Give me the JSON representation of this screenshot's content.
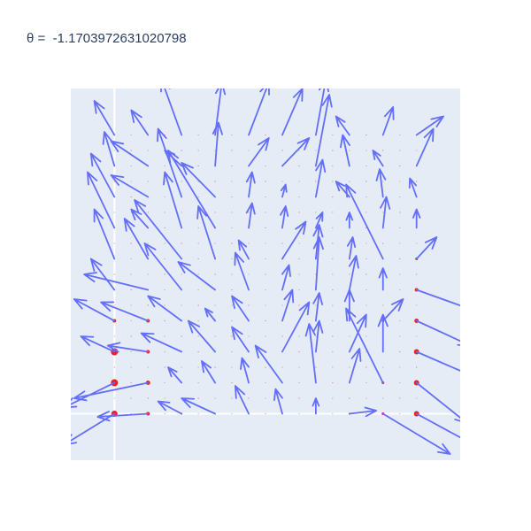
{
  "chart_data": {
    "type": "quiver",
    "title": "θ =  -1.1703972631020798",
    "xlabel": "",
    "ylabel": "",
    "xlim": [
      -1.3,
      10.3
    ],
    "ylim": [
      -1.5,
      10.5
    ],
    "grid": false,
    "zero_lines": true,
    "colors": {
      "arrows": "#636efa",
      "markers": "#ef1f1f",
      "plot_bg": "#e5ecf6",
      "paper_bg": "#ffffff",
      "zeroline": "#ffffff",
      "title": "#2a3f5f"
    },
    "grid_spacing": 0.5,
    "arrows": [
      {
        "x": 0,
        "y": 9,
        "u": -0.6,
        "v": 1.1
      },
      {
        "x": 0,
        "y": 8,
        "u": -0.3,
        "v": 1.1
      },
      {
        "x": 0,
        "y": 7,
        "u": -0.7,
        "v": 1.4
      },
      {
        "x": 0,
        "y": 6,
        "u": -0.8,
        "v": 1.8
      },
      {
        "x": 0,
        "y": 5,
        "u": -0.6,
        "v": 1.6
      },
      {
        "x": 0,
        "y": 4,
        "u": -0.7,
        "v": 1.0
      },
      {
        "x": 0,
        "y": 3,
        "u": -1.2,
        "v": 0.7
      },
      {
        "x": 0,
        "y": 2,
        "u": -1.0,
        "v": 0.5
      },
      {
        "x": 0,
        "y": 1,
        "u": -1.5,
        "v": -0.8
      },
      {
        "x": 0,
        "y": 0,
        "u": -1.5,
        "v": -1.0
      },
      {
        "x": 1,
        "y": 9,
        "u": -0.5,
        "v": 0.8
      },
      {
        "x": 1,
        "y": 8,
        "u": -1.1,
        "v": 0.8
      },
      {
        "x": 1,
        "y": 7,
        "u": -1.1,
        "v": 0.7
      },
      {
        "x": 1,
        "y": 6,
        "u": -0.5,
        "v": 0.6
      },
      {
        "x": 1,
        "y": 5,
        "u": -0.7,
        "v": 1.3
      },
      {
        "x": 1,
        "y": 4,
        "u": -1.9,
        "v": 0.5
      },
      {
        "x": 1,
        "y": 3,
        "u": -1.4,
        "v": 0.6
      },
      {
        "x": 1,
        "y": 2,
        "u": -1.2,
        "v": 0.2
      },
      {
        "x": 1,
        "y": 1,
        "u": -2.2,
        "v": -0.5
      },
      {
        "x": 1,
        "y": 0,
        "u": -1.5,
        "v": -0.1
      },
      {
        "x": 2,
        "y": 9,
        "u": -0.6,
        "v": 1.8
      },
      {
        "x": 2,
        "y": 8,
        "u": -0.5,
        "v": 0.5
      },
      {
        "x": 2,
        "y": 7,
        "u": -0.7,
        "v": 2.2
      },
      {
        "x": 2,
        "y": 6,
        "u": -0.5,
        "v": 1.8
      },
      {
        "x": 2,
        "y": 5,
        "u": -1.4,
        "v": 1.9
      },
      {
        "x": 2,
        "y": 4,
        "u": -1.1,
        "v": 1.5
      },
      {
        "x": 2,
        "y": 3,
        "u": -1.0,
        "v": 0.8
      },
      {
        "x": 2,
        "y": 2,
        "u": -1.2,
        "v": 0.6
      },
      {
        "x": 2,
        "y": 1,
        "u": -0.4,
        "v": 0.5
      },
      {
        "x": 2,
        "y": 0,
        "u": -0.7,
        "v": 0.4
      },
      {
        "x": 3,
        "y": 9,
        "u": 0.2,
        "v": 1.7
      },
      {
        "x": 3,
        "y": 8,
        "u": 0.1,
        "v": 1.4
      },
      {
        "x": 3,
        "y": 7,
        "u": -1.0,
        "v": 1.1
      },
      {
        "x": 3,
        "y": 6,
        "u": -1.4,
        "v": 2.5
      },
      {
        "x": 3,
        "y": 5,
        "u": -0.5,
        "v": 1.7
      },
      {
        "x": 3,
        "y": 4,
        "u": -1.1,
        "v": 0.9
      },
      {
        "x": 3,
        "y": 3,
        "u": -0.3,
        "v": 0.4
      },
      {
        "x": 3,
        "y": 2,
        "u": -0.8,
        "v": 1.0
      },
      {
        "x": 3,
        "y": 1,
        "u": -0.4,
        "v": 0.7
      },
      {
        "x": 3,
        "y": 0,
        "u": -1.0,
        "v": 0.5
      },
      {
        "x": 4,
        "y": 9,
        "u": 0.6,
        "v": 1.7
      },
      {
        "x": 4,
        "y": 8,
        "u": 0.6,
        "v": 0.9
      },
      {
        "x": 4,
        "y": 7,
        "u": 0.1,
        "v": 0.8
      },
      {
        "x": 4,
        "y": 6,
        "u": 0.1,
        "v": 0.8
      },
      {
        "x": 4,
        "y": 5,
        "u": -0.3,
        "v": 0.6
      },
      {
        "x": 4,
        "y": 4,
        "u": -0.4,
        "v": 1.2
      },
      {
        "x": 4,
        "y": 3,
        "u": -0.5,
        "v": 0.8
      },
      {
        "x": 4,
        "y": 2,
        "u": -0.5,
        "v": 0.8
      },
      {
        "x": 4,
        "y": 1,
        "u": -0.2,
        "v": 0.8
      },
      {
        "x": 4,
        "y": 0,
        "u": -0.4,
        "v": 0.9
      },
      {
        "x": 5,
        "y": 9,
        "u": 0.6,
        "v": 1.5
      },
      {
        "x": 5,
        "y": 8,
        "u": 0.8,
        "v": 0.9
      },
      {
        "x": 5,
        "y": 7,
        "u": 0.1,
        "v": 0.4
      },
      {
        "x": 5,
        "y": 6,
        "u": 0.1,
        "v": 0.7
      },
      {
        "x": 5,
        "y": 5,
        "u": 0.7,
        "v": 1.2
      },
      {
        "x": 5,
        "y": 4,
        "u": 0.2,
        "v": 0.8
      },
      {
        "x": 5,
        "y": 3,
        "u": 0.3,
        "v": 1.0
      },
      {
        "x": 5,
        "y": 2,
        "u": 0.8,
        "v": 1.6
      },
      {
        "x": 5,
        "y": 1,
        "u": -0.8,
        "v": 1.2
      },
      {
        "x": 5,
        "y": 0,
        "u": -0.2,
        "v": 0.8
      },
      {
        "x": 6,
        "y": 9,
        "u": 0.3,
        "v": 1.8
      },
      {
        "x": 6,
        "y": 8,
        "u": 0.4,
        "v": 2.3
      },
      {
        "x": 6,
        "y": 7,
        "u": 0.2,
        "v": 1.2
      },
      {
        "x": 6,
        "y": 6,
        "u": 0.2,
        "v": 0.5
      },
      {
        "x": 6,
        "y": 5,
        "u": 0.1,
        "v": 1.1
      },
      {
        "x": 6,
        "y": 4,
        "u": 0.1,
        "v": 1.7
      },
      {
        "x": 6,
        "y": 3,
        "u": 0.1,
        "v": 0.9
      },
      {
        "x": 6,
        "y": 2,
        "u": 0.1,
        "v": 1.0
      },
      {
        "x": 6,
        "y": 1,
        "u": -0.2,
        "v": 1.9
      },
      {
        "x": 6,
        "y": 0,
        "u": 0.0,
        "v": 0.5
      },
      {
        "x": 7,
        "y": 9,
        "u": -0.4,
        "v": 0.6
      },
      {
        "x": 7,
        "y": 8,
        "u": -0.2,
        "v": 1.0
      },
      {
        "x": 7,
        "y": 7,
        "u": -0.4,
        "v": 0.5
      },
      {
        "x": 7,
        "y": 6,
        "u": 0.0,
        "v": 0.5
      },
      {
        "x": 7,
        "y": 5,
        "u": 0.1,
        "v": 0.7
      },
      {
        "x": 7,
        "y": 4,
        "u": 0.2,
        "v": 1.1
      },
      {
        "x": 7,
        "y": 3,
        "u": 0.0,
        "v": 1.0
      },
      {
        "x": 7,
        "y": 2,
        "u": 0.5,
        "v": 1.2
      },
      {
        "x": 7,
        "y": 1,
        "u": 0.3,
        "v": 1.1
      },
      {
        "x": 7,
        "y": 0,
        "u": 0.8,
        "v": 0.1
      },
      {
        "x": 8,
        "y": 9,
        "u": 0.3,
        "v": 0.9
      },
      {
        "x": 8,
        "y": 8,
        "u": -0.3,
        "v": 0.5
      },
      {
        "x": 8,
        "y": 7,
        "u": -0.1,
        "v": 0.9
      },
      {
        "x": 8,
        "y": 6,
        "u": 0.1,
        "v": 1.0
      },
      {
        "x": 8,
        "y": 5,
        "u": -1.1,
        "v": 2.4
      },
      {
        "x": 8,
        "y": 4,
        "u": 0.0,
        "v": 0.7
      },
      {
        "x": 8,
        "y": 3,
        "u": 0.6,
        "v": 0.7
      },
      {
        "x": 8,
        "y": 2,
        "u": 0.0,
        "v": 1.2
      },
      {
        "x": 8,
        "y": 1,
        "u": -1.1,
        "v": 2.4
      },
      {
        "x": 8,
        "y": 0,
        "u": 2.0,
        "v": -1.3
      },
      {
        "x": 9,
        "y": 9,
        "u": 0.8,
        "v": 0.6
      },
      {
        "x": 9,
        "y": 8,
        "u": 0.5,
        "v": 1.2
      },
      {
        "x": 9,
        "y": 7,
        "u": -0.2,
        "v": 0.6
      },
      {
        "x": 9,
        "y": 6,
        "u": 0.0,
        "v": 0.6
      },
      {
        "x": 9,
        "y": 5,
        "u": 0.6,
        "v": 0.7
      },
      {
        "x": 9,
        "y": 4,
        "u": 1.8,
        "v": -0.7
      },
      {
        "x": 9,
        "y": 3,
        "u": 1.6,
        "v": -0.8
      },
      {
        "x": 9,
        "y": 2,
        "u": 1.7,
        "v": -0.8
      },
      {
        "x": 9,
        "y": 1,
        "u": 1.5,
        "v": -1.3
      },
      {
        "x": 9,
        "y": 0,
        "u": 1.7,
        "v": -1.0
      }
    ],
    "markers": [
      {
        "x": 0,
        "y": 0,
        "size": 3.5
      },
      {
        "x": 0,
        "y": 1,
        "size": 4
      },
      {
        "x": 0,
        "y": 2,
        "size": 4
      },
      {
        "x": 0,
        "y": 3,
        "size": 2
      },
      {
        "x": 1,
        "y": 0,
        "size": 2
      },
      {
        "x": 1,
        "y": 1,
        "size": 2.5
      },
      {
        "x": 1,
        "y": 2,
        "size": 2
      },
      {
        "x": 1,
        "y": 3,
        "size": 2
      },
      {
        "x": 9,
        "y": 0,
        "size": 3
      },
      {
        "x": 9,
        "y": 1,
        "size": 3
      },
      {
        "x": 9,
        "y": 2,
        "size": 3
      },
      {
        "x": 9,
        "y": 3,
        "size": 2.5
      },
      {
        "x": 9,
        "y": 4,
        "size": 2
      },
      {
        "x": 9,
        "y": 5,
        "size": 1.5
      },
      {
        "x": 8,
        "y": 0,
        "size": 1.5
      },
      {
        "x": 8,
        "y": 1,
        "size": 1.5
      },
      {
        "x": 8,
        "y": 3,
        "size": 1.5
      },
      {
        "x": 2,
        "y": 0,
        "size": 1
      },
      {
        "x": 7,
        "y": 0,
        "size": 1
      }
    ]
  }
}
